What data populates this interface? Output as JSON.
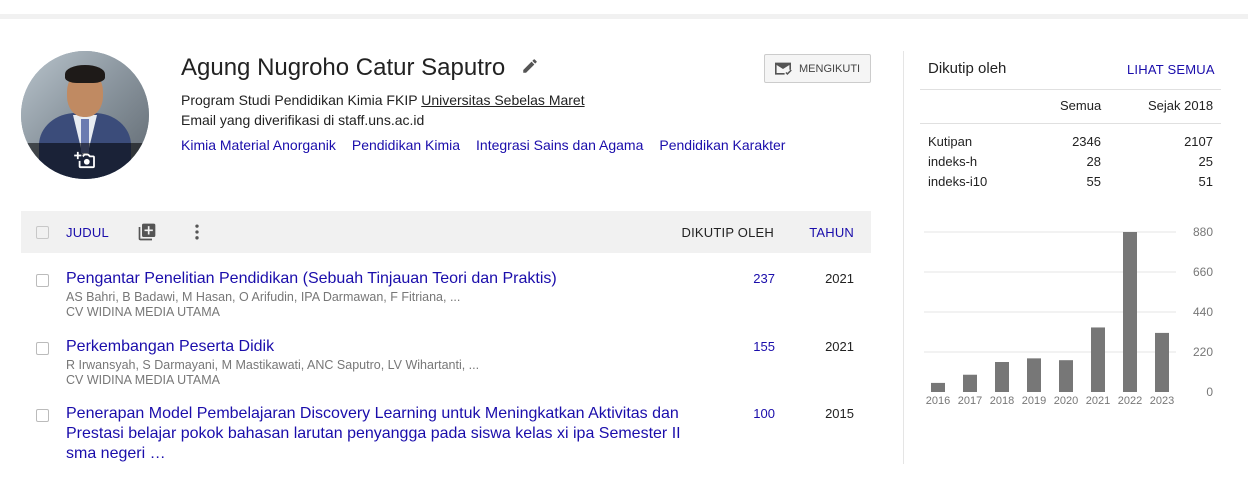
{
  "profile": {
    "name": "Agung Nugroho Catur Saputro",
    "affiliation_prefix": "Program Studi Pendidikan Kimia FKIP",
    "affiliation_link": "Universitas Sebelas Maret",
    "email": "Email yang diverifikasi di staff.uns.ac.id",
    "follow_label": "MENGIKUTI",
    "interests": [
      "Kimia Material Anorganik",
      "Pendidikan Kimia",
      "Integrasi Sains dan Agama",
      "Pendidikan Karakter"
    ]
  },
  "table": {
    "col_title": "JUDUL",
    "col_cited": "DIKUTIP OLEH",
    "col_year": "TAHUN",
    "rows": [
      {
        "title": "Pengantar Penelitian Pendidikan (Sebuah Tinjauan Teori dan Praktis)",
        "authors": "AS Bahri, B Badawi, M Hasan, O Arifudin, IPA Darmawan, F Fitriana, ...",
        "venue": "CV WIDINA MEDIA UTAMA",
        "cited": "237",
        "year": "2021"
      },
      {
        "title": "Perkembangan Peserta Didik",
        "authors": "R Irwansyah, S Darmayani, M Mastikawati, ANC Saputro, LV Wihartanti, ...",
        "venue": "CV WIDINA MEDIA UTAMA",
        "cited": "155",
        "year": "2021"
      },
      {
        "title": "Penerapan Model Pembelajaran Discovery Learning untuk Meningkatkan Aktivitas dan Prestasi belajar pokok bahasan larutan penyangga pada siswa kelas xi ipa Semester II sma negeri …",
        "authors": "",
        "venue": "",
        "cited": "100",
        "year": "2015"
      }
    ]
  },
  "cited_by": {
    "title": "Dikutip oleh",
    "see_all": "LIHAT SEMUA",
    "col_all": "Semua",
    "col_since": "Sejak 2018",
    "stats": [
      {
        "label": "Kutipan",
        "all": "2346",
        "since": "2107"
      },
      {
        "label": "indeks-h",
        "all": "28",
        "since": "25"
      },
      {
        "label": "indeks-i10",
        "all": "55",
        "since": "51"
      }
    ]
  },
  "chart_data": {
    "type": "bar",
    "categories": [
      "2016",
      "2017",
      "2018",
      "2019",
      "2020",
      "2021",
      "2022",
      "2023"
    ],
    "values": [
      50,
      95,
      165,
      185,
      175,
      355,
      880,
      325
    ],
    "yticks": [
      0,
      220,
      440,
      660,
      880
    ],
    "ylim": [
      0,
      880
    ],
    "grid": true,
    "bar_color": "#777777"
  },
  "colors": {
    "link": "#1a0dab",
    "header_bg": "#f1f1f1"
  }
}
